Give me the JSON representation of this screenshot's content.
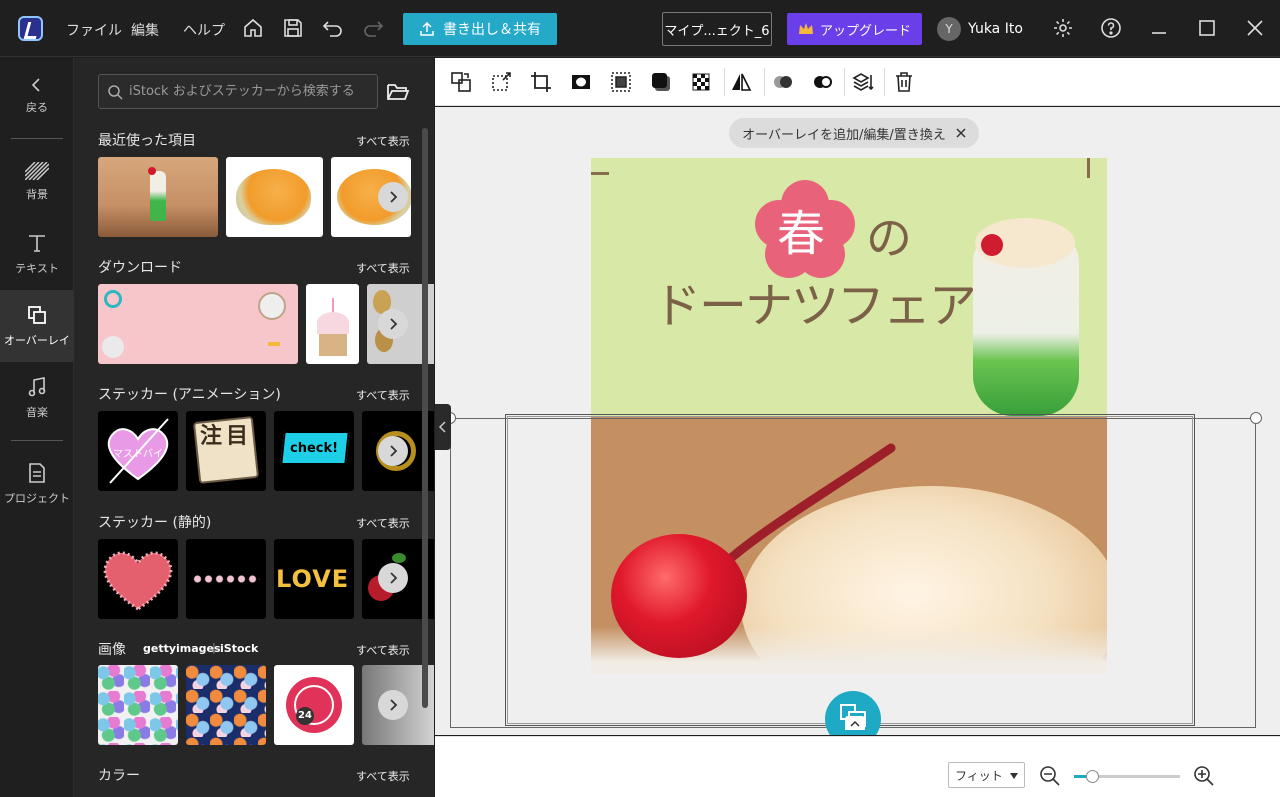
{
  "menu": {
    "file": "ファイル",
    "edit": "編集",
    "help": "ヘルプ"
  },
  "export_label": "書き出し＆共有",
  "project_name": "マイプ...ェクト_6",
  "upgrade_label": "アップグレード",
  "user": {
    "initial": "Y",
    "name": "Yuka Ito"
  },
  "rail": {
    "back": "戻る",
    "background": "背景",
    "text": "テキスト",
    "overlay": "オーバーレイ",
    "music": "音楽",
    "project": "プロジェクト"
  },
  "search_placeholder": "iStock およびステッカーから検索する",
  "see_all": "すべて表示",
  "sections": {
    "recent": "最近使った項目",
    "download": "ダウンロード",
    "sticker_anim": "ステッカー (アニメーション)",
    "sticker_static": "ステッカー (静的)",
    "image": "画像",
    "color": "カラー"
  },
  "brands": {
    "getty": "gettyimages",
    "istock": "iStock"
  },
  "sticker_text": {
    "mustbuy": "マストバイ",
    "notice": "注目",
    "check": "check!",
    "love": "LOVE",
    "clock": "24"
  },
  "overlay_chip": "オーバーレイを追加/編集/置き換え",
  "canvas_text": {
    "spring": "春",
    "no": "の",
    "fair": "ドーナツフェア"
  },
  "zoom": {
    "mode": "フィット",
    "level": 0.17
  },
  "colors": {
    "accent": "#25a9c8",
    "upgrade": "#6a3ee8",
    "canvas_green": "#d8e8a6",
    "title_pink": "#e8637a"
  }
}
